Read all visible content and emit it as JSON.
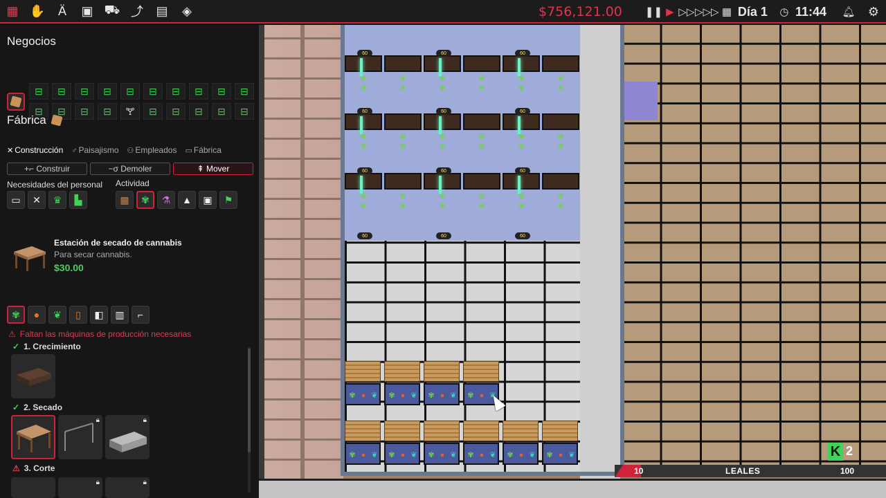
{
  "topbar": {
    "money": "$756,121.00",
    "day": "Día 1",
    "time": "11:44",
    "icons": [
      "menu-icon",
      "hand-tools-icon",
      "font-icon",
      "briefcase-icon",
      "truck-icon",
      "chart-icon",
      "document-icon",
      "layers-icon"
    ],
    "controls": [
      "pause-icon",
      "play-icon",
      "fast-forward-icon",
      "fastest-icon"
    ],
    "accent": "#d0223a"
  },
  "panel": {
    "businesses_title": "Negocios",
    "factory_title": "Fábrica",
    "tabs": [
      {
        "label": "Construcción",
        "icon": "wrench-icon"
      },
      {
        "label": "Paisajismo",
        "icon": "plant-icon"
      },
      {
        "label": "Empleados",
        "icon": "people-icon"
      },
      {
        "label": "Fábrica",
        "icon": "building-icon"
      }
    ],
    "actions": [
      {
        "label": "Construir"
      },
      {
        "label": "Demoler"
      },
      {
        "label": "Mover"
      }
    ],
    "staff_needs_label": "Necesidades del personal",
    "activity_label": "Actividad",
    "item": {
      "name": "Estación de secado de cannabis",
      "description": "Para secar cannabis.",
      "price": "$30.00"
    },
    "warning": "Faltan las máquinas de producción necesarias",
    "stages": [
      {
        "label": "1. Crecimiento",
        "done": true
      },
      {
        "label": "2. Secado",
        "done": true
      },
      {
        "label": "3. Corte",
        "done": false
      }
    ]
  },
  "hud": {
    "loyalty_label": "LEALES",
    "loyalty_min": "10",
    "loyalty_max": "100",
    "k_badge": "K",
    "k_count": "2"
  },
  "lamp_label": "60"
}
